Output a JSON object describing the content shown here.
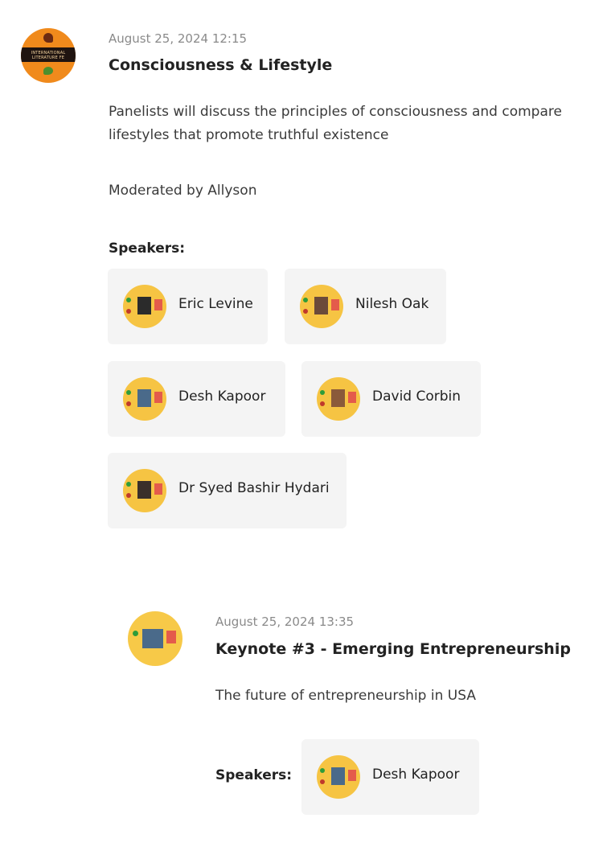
{
  "session1": {
    "avatar_name": "INTERNATIONAL LITERATURE FE",
    "date": "August 25, 2024 12:15",
    "title": "Consciousness & Lifestyle",
    "description": "Panelists will discuss the principles of consciousness and compare lifestyles that promote truthful existence",
    "moderator": "Moderated by Allyson",
    "speakers_label": "Speakers:",
    "speakers": [
      {
        "name": "Eric Levine"
      },
      {
        "name": "Nilesh Oak"
      },
      {
        "name": "Desh Kapoor"
      },
      {
        "name": "David Corbin"
      },
      {
        "name": "Dr Syed Bashir Hydari"
      }
    ]
  },
  "session2": {
    "date": "August 25, 2024 13:35",
    "title": "Keynote #3 - Emerging Entrepreneurship",
    "description": "The future of entrepreneurship in USA",
    "speakers_label": "Speakers:",
    "speakers": [
      {
        "name": "Desh Kapoor"
      }
    ]
  },
  "colors": {
    "chip_bg": "#f4f4f4",
    "avatar_bg": "#f6c443",
    "date_text": "#8a8a8a"
  }
}
